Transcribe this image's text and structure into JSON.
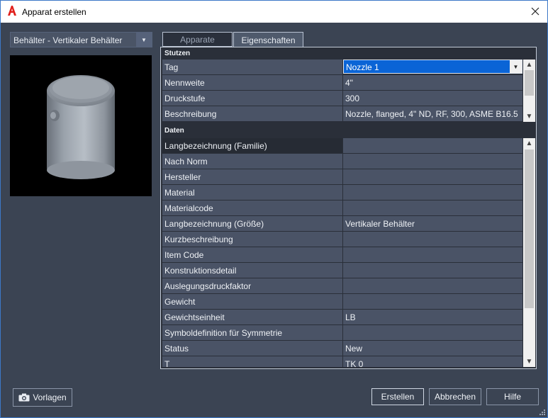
{
  "window": {
    "title": "Apparat erstellen"
  },
  "equipment_select": {
    "value": "Behälter - Vertikaler Behälter"
  },
  "tabs": [
    {
      "label": "Apparate",
      "active": false
    },
    {
      "label": "Eigenschaften",
      "active": true
    }
  ],
  "stutzen": {
    "header": "Stutzen",
    "rows": [
      {
        "label": "Tag",
        "value": "Nozzle 1"
      },
      {
        "label": "Nennweite",
        "value": "4\""
      },
      {
        "label": "Druckstufe",
        "value": "300"
      },
      {
        "label": "Beschreibung",
        "value": "Nozzle, flanged, 4\" ND, RF, 300, ASME B16.5"
      }
    ]
  },
  "daten": {
    "header": "Daten",
    "rows": [
      {
        "label": "Langbezeichnung (Familie)",
        "value": ""
      },
      {
        "label": "Nach Norm",
        "value": ""
      },
      {
        "label": "Hersteller",
        "value": ""
      },
      {
        "label": "Material",
        "value": ""
      },
      {
        "label": "Materialcode",
        "value": ""
      },
      {
        "label": "Langbezeichnung (Größe)",
        "value": "Vertikaler Behälter"
      },
      {
        "label": "Kurzbeschreibung",
        "value": ""
      },
      {
        "label": "Item Code",
        "value": ""
      },
      {
        "label": "Konstruktionsdetail",
        "value": ""
      },
      {
        "label": "Auslegungsdruckfaktor",
        "value": ""
      },
      {
        "label": "Gewicht",
        "value": ""
      },
      {
        "label": "Gewichtseinheit",
        "value": "LB"
      },
      {
        "label": "Symboldefinition für Symmetrie",
        "value": ""
      },
      {
        "label": "Status",
        "value": "New"
      },
      {
        "label": "T",
        "value": "TK 0"
      }
    ]
  },
  "buttons": {
    "vorlagen": "Vorlagen",
    "erstellen": "Erstellen",
    "abbrechen": "Abbrechen",
    "hilfe": "Hilfe"
  },
  "colors": {
    "background": "#3b4453",
    "panel": "#2a2f39",
    "cell": "#4a5366",
    "selection": "#0a64d6",
    "accent_icon": "#e0201c"
  }
}
